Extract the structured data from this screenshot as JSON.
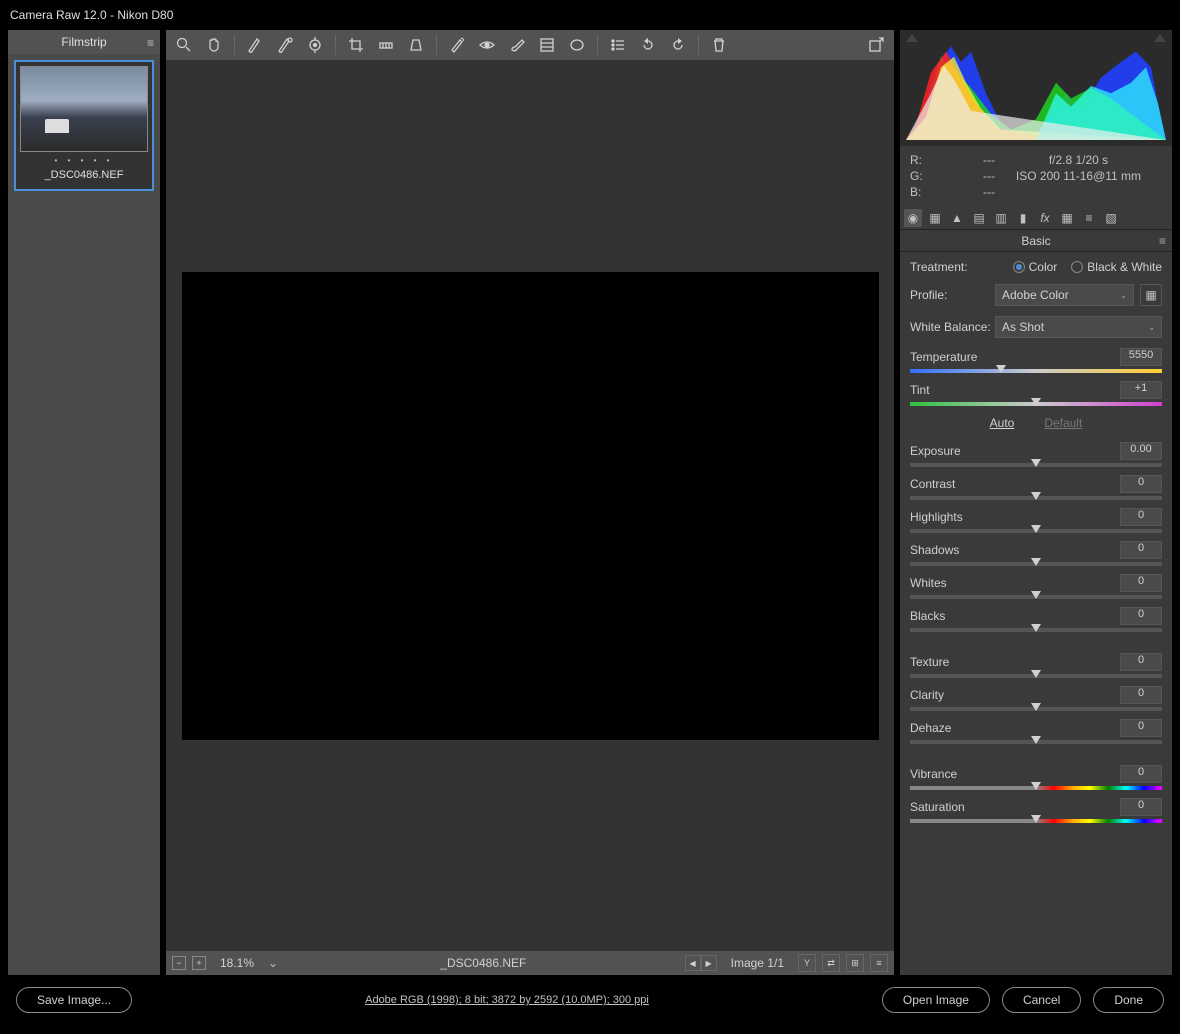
{
  "titlebar": "Camera Raw 12.0  -  Nikon D80",
  "filmstrip": {
    "title": "Filmstrip",
    "thumb_name": "_DSC0486.NEF"
  },
  "statusbar": {
    "zoom": "18.1%",
    "filename": "_DSC0486.NEF",
    "image_count": "Image 1/1"
  },
  "info": {
    "r_label": "R:",
    "r_value": "---",
    "g_label": "G:",
    "g_value": "---",
    "b_label": "B:",
    "b_value": "---",
    "exposure_line": "f/2.8    1/20 s",
    "iso_line": "ISO 200    11-16@11 mm"
  },
  "panel": {
    "title": "Basic",
    "treatment_label": "Treatment:",
    "treatment_color": "Color",
    "treatment_bw": "Black & White",
    "profile_label": "Profile:",
    "profile_value": "Adobe Color",
    "wb_label": "White Balance:",
    "wb_value": "As Shot",
    "auto": "Auto",
    "default": "Default",
    "sliders": {
      "temperature": {
        "label": "Temperature",
        "value": "5550",
        "pos": 36
      },
      "tint": {
        "label": "Tint",
        "value": "+1",
        "pos": 50
      },
      "exposure": {
        "label": "Exposure",
        "value": "0.00",
        "pos": 50
      },
      "contrast": {
        "label": "Contrast",
        "value": "0",
        "pos": 50
      },
      "highlights": {
        "label": "Highlights",
        "value": "0",
        "pos": 50
      },
      "shadows": {
        "label": "Shadows",
        "value": "0",
        "pos": 50
      },
      "whites": {
        "label": "Whites",
        "value": "0",
        "pos": 50
      },
      "blacks": {
        "label": "Blacks",
        "value": "0",
        "pos": 50
      },
      "texture": {
        "label": "Texture",
        "value": "0",
        "pos": 50
      },
      "clarity": {
        "label": "Clarity",
        "value": "0",
        "pos": 50
      },
      "dehaze": {
        "label": "Dehaze",
        "value": "0",
        "pos": 50
      },
      "vibrance": {
        "label": "Vibrance",
        "value": "0",
        "pos": 50
      },
      "saturation": {
        "label": "Saturation",
        "value": "0",
        "pos": 50
      }
    }
  },
  "bottom": {
    "save_image": "Save Image...",
    "workflow": "Adobe RGB (1998); 8 bit; 3872 by 2592 (10.0MP); 300 ppi",
    "open_image": "Open Image",
    "cancel": "Cancel",
    "done": "Done"
  }
}
